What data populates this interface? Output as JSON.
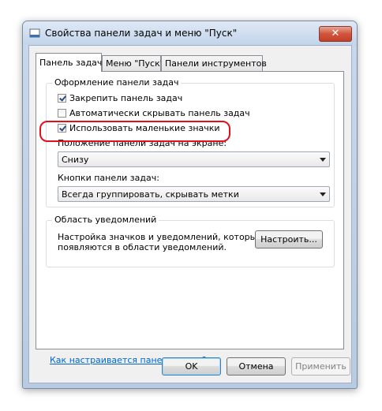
{
  "window": {
    "title": "Свойства панели задач и меню \"Пуск\"",
    "close_label": "✕"
  },
  "tabs": [
    {
      "label": "Панель задач",
      "active": true
    },
    {
      "label": "Меню \"Пуск\"",
      "active": false
    },
    {
      "label": "Панели инструментов",
      "active": false
    }
  ],
  "appearance_group": {
    "legend": "Оформление панели задач",
    "checkboxes": [
      {
        "label": "Закрепить панель задач",
        "checked": true
      },
      {
        "label": "Автоматически скрывать панель задач",
        "checked": false
      },
      {
        "label": "Использовать маленькие значки",
        "checked": true
      }
    ],
    "position_label": "Положение панели задач на экране:",
    "position_value": "Снизу",
    "buttons_label": "Кнопки панели задач:",
    "buttons_value": "Всегда группировать, скрывать метки"
  },
  "notification_group": {
    "legend": "Область уведомлений",
    "description_line1": "Настройка значков и уведомлений, которые",
    "description_line2": "появляются в области уведомлений.",
    "customize_label": "Настроить..."
  },
  "help_link": "Как настраивается панель задач?",
  "footer": {
    "ok_label": "OK",
    "cancel_label": "Отмена",
    "apply_label": "Применить"
  },
  "colors": {
    "highlight": "#e0101c",
    "link": "#0066cc"
  }
}
